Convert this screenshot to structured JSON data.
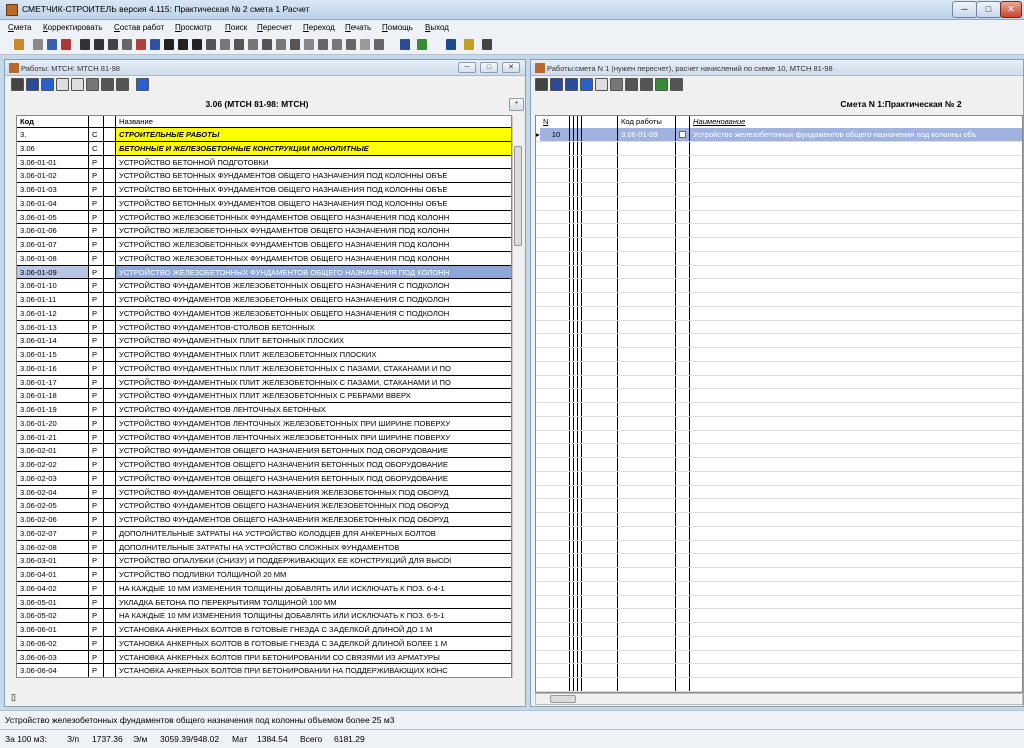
{
  "app": {
    "title": "СМЕТЧИК-СТРОИТЕЛЬ версия  4.115: Практическая № 2 смета 1 Расчет",
    "min": "─",
    "max": "□",
    "close": "✕"
  },
  "menu": [
    {
      "first": "С",
      "rest": "мета"
    },
    {
      "first": "К",
      "rest": "орректировать"
    },
    {
      "first": "С",
      "rest": "остав работ"
    },
    {
      "first": "П",
      "rest": "росмотр"
    },
    {
      "first": "П",
      "rest": "оиск"
    },
    {
      "first": "П",
      "rest": "ересчет"
    },
    {
      "first": "П",
      "rest": "ереход"
    },
    {
      "first": "П",
      "rest": "ечать"
    },
    {
      "first": "П",
      "rest": "омощь"
    },
    {
      "first": "В",
      "rest": "ыход"
    }
  ],
  "left_window": {
    "title": "Работы: МТСН: МТСН 81-98",
    "heading": "3.06 (МТСН 81-98: МТСН)",
    "plus": "+",
    "columns": {
      "code": "Код",
      "name": "Название"
    },
    "rows": [
      {
        "code": "3.",
        "type": "С",
        "name": "СТРОИТЕЛЬНЫЕ РАБОТЫ",
        "style": "section"
      },
      {
        "code": "3.06",
        "type": "С",
        "name": "БЕТОННЫЕ И ЖЕЛЕЗОБЕТОННЫЕ КОНСТРУКЦИИ МОНОЛИТНЫЕ",
        "style": "section"
      },
      {
        "code": "3.06-01-01",
        "type": "Р",
        "name": "УСТРОЙСТВО БЕТОННОЙ ПОДГОТОВКИ"
      },
      {
        "code": "3.06-01-02",
        "type": "Р",
        "name": "УСТРОЙСТВО БЕТОННЫХ ФУНДАМЕНТОВ ОБЩЕГО НАЗНАЧЕНИЯ ПОД КОЛОННЫ ОБЪЕ"
      },
      {
        "code": "3.06-01-03",
        "type": "Р",
        "name": "УСТРОЙСТВО БЕТОННЫХ ФУНДАМЕНТОВ ОБЩЕГО НАЗНАЧЕНИЯ ПОД КОЛОННЫ ОБЪЕ"
      },
      {
        "code": "3.06-01-04",
        "type": "Р",
        "name": "УСТРОЙСТВО БЕТОННЫХ ФУНДАМЕНТОВ ОБЩЕГО НАЗНАЧЕНИЯ ПОД КОЛОННЫ ОБЪЕ"
      },
      {
        "code": "3.06-01-05",
        "type": "Р",
        "name": "УСТРОЙСТВО ЖЕЛЕЗОБЕТОННЫХ ФУНДАМЕНТОВ ОБЩЕГО НАЗНАЧЕНИЯ ПОД КОЛОНН"
      },
      {
        "code": "3.06-01-06",
        "type": "Р",
        "name": "УСТРОЙСТВО ЖЕЛЕЗОБЕТОННЫХ ФУНДАМЕНТОВ ОБЩЕГО НАЗНАЧЕНИЯ ПОД КОЛОНН"
      },
      {
        "code": "3.06-01-07",
        "type": "Р",
        "name": "УСТРОЙСТВО ЖЕЛЕЗОБЕТОННЫХ ФУНДАМЕНТОВ ОБЩЕГО НАЗНАЧЕНИЯ ПОД КОЛОНН"
      },
      {
        "code": "3.06-01-08",
        "type": "Р",
        "name": "УСТРОЙСТВО ЖЕЛЕЗОБЕТОННЫХ ФУНДАМЕНТОВ ОБЩЕГО НАЗНАЧЕНИЯ ПОД КОЛОНН"
      },
      {
        "code": "3.06-01-09",
        "type": "Р",
        "name": "УСТРОЙСТВО ЖЕЛЕЗОБЕТОННЫХ ФУНДАМЕНТОВ ОБЩЕГО НАЗНАЧЕНИЯ ПОД КОЛОНН",
        "style": "selected"
      },
      {
        "code": "3.06-01-10",
        "type": "Р",
        "name": "УСТРОЙСТВО ФУНДАМЕНТОВ ЖЕЛЕЗОБЕТОННЫХ ОБЩЕГО НАЗНАЧЕНИЯ С ПОДКОЛОН"
      },
      {
        "code": "3.06-01-11",
        "type": "Р",
        "name": "УСТРОЙСТВО ФУНДАМЕНТОВ ЖЕЛЕЗОБЕТОННЫХ ОБЩЕГО НАЗНАЧЕНИЯ С ПОДКОЛОН"
      },
      {
        "code": "3.06-01-12",
        "type": "Р",
        "name": "УСТРОЙСТВО ФУНДАМЕНТОВ ЖЕЛЕЗОБЕТОННЫХ ОБЩЕГО НАЗНАЧЕНИЯ С ПОДКОЛОН"
      },
      {
        "code": "3.06-01-13",
        "type": "Р",
        "name": "УСТРОЙСТВО ФУНДАМЕНТОВ-СТОЛБОВ БЕТОННЫХ"
      },
      {
        "code": "3.06-01-14",
        "type": "Р",
        "name": "УСТРОЙСТВО ФУНДАМЕНТНЫХ ПЛИТ БЕТОННЫХ ПЛОСКИХ"
      },
      {
        "code": "3.06-01-15",
        "type": "Р",
        "name": "УСТРОЙСТВО ФУНДАМЕНТНЫХ ПЛИТ ЖЕЛЕЗОБЕТОННЫХ ПЛОСКИХ"
      },
      {
        "code": "3.06-01-16",
        "type": "Р",
        "name": "УСТРОЙСТВО ФУНДАМЕНТНЫХ ПЛИТ ЖЕЛЕЗОБЕТОННЫХ С ПАЗАМИ, СТАКАНАМИ И ПО"
      },
      {
        "code": "3.06-01-17",
        "type": "Р",
        "name": "УСТРОЙСТВО ФУНДАМЕНТНЫХ ПЛИТ ЖЕЛЕЗОБЕТОННЫХ С ПАЗАМИ, СТАКАНАМИ И ПО"
      },
      {
        "code": "3.06-01-18",
        "type": "Р",
        "name": "УСТРОЙСТВО ФУНДАМЕНТНЫХ ПЛИТ ЖЕЛЕЗОБЕТОННЫХ С РЕБРАМИ ВВЕРХ"
      },
      {
        "code": "3.06-01-19",
        "type": "Р",
        "name": "УСТРОЙСТВО ФУНДАМЕНТОВ ЛЕНТОЧНЫХ БЕТОННЫХ"
      },
      {
        "code": "3.06-01-20",
        "type": "Р",
        "name": "УСТРОЙСТВО ФУНДАМЕНТОВ ЛЕНТОЧНЫХ ЖЕЛЕЗОБЕТОННЫХ ПРИ ШИРИНЕ ПОВЕРХУ"
      },
      {
        "code": "3.06-01-21",
        "type": "Р",
        "name": "УСТРОЙСТВО ФУНДАМЕНТОВ ЛЕНТОЧНЫХ ЖЕЛЕЗОБЕТОННЫХ ПРИ ШИРИНЕ ПОВЕРХУ"
      },
      {
        "code": "3.06-02-01",
        "type": "Р",
        "name": "УСТРОЙСТВО ФУНДАМЕНТОВ ОБЩЕГО НАЗНАЧЕНИЯ БЕТОННЫХ ПОД ОБОРУДОВАНИЕ"
      },
      {
        "code": "3.06-02-02",
        "type": "Р",
        "name": "УСТРОЙСТВО ФУНДАМЕНТОВ ОБЩЕГО НАЗНАЧЕНИЯ БЕТОННЫХ ПОД ОБОРУДОВАНИЕ"
      },
      {
        "code": "3.06-02-03",
        "type": "Р",
        "name": "УСТРОЙСТВО ФУНДАМЕНТОВ ОБЩЕГО НАЗНАЧЕНИЯ БЕТОННЫХ ПОД ОБОРУДОВАНИЕ"
      },
      {
        "code": "3.06-02-04",
        "type": "Р",
        "name": "УСТРОЙСТВО ФУНДАМЕНТОВ ОБЩЕГО НАЗНАЧЕНИЯ ЖЕЛЕЗОБЕТОННЫХ ПОД ОБОРУД"
      },
      {
        "code": "3.06-02-05",
        "type": "Р",
        "name": "УСТРОЙСТВО ФУНДАМЕНТОВ ОБЩЕГО НАЗНАЧЕНИЯ ЖЕЛЕЗОБЕТОННЫХ ПОД ОБОРУД"
      },
      {
        "code": "3.06-02-06",
        "type": "Р",
        "name": "УСТРОЙСТВО ФУНДАМЕНТОВ ОБЩЕГО НАЗНАЧЕНИЯ ЖЕЛЕЗОБЕТОННЫХ ПОД ОБОРУД"
      },
      {
        "code": "3.06-02-07",
        "type": "Р",
        "name": "ДОПОЛНИТЕЛЬНЫЕ ЗАТРАТЫ НА УСТРОЙСТВО КОЛОДЦЕВ ДЛЯ АНКЕРНЫХ БОЛТОВ"
      },
      {
        "code": "3.06-02-08",
        "type": "Р",
        "name": "ДОПОЛНИТЕЛЬНЫЕ ЗАТРАТЫ НА УСТРОЙСТВО СЛОЖНЫХ ФУНДАМЕНТОВ"
      },
      {
        "code": "3.06-03-01",
        "type": "Р",
        "name": "УСТРОЙСТВО ОПАЛУБКИ (СНИЗУ) И ПОДДЕРЖИВАЮЩИХ ЕЕ КОНСТРУКЦИЙ ДЛЯ ВЫСОІ"
      },
      {
        "code": "3.06-04-01",
        "type": "Р",
        "name": "УСТРОЙСТВО ПОДЛИВКИ ТОЛЩИНОЙ 20 ММ"
      },
      {
        "code": "3.06-04-02",
        "type": "Р",
        "name": "НА КАЖДЫЕ 10 ММ ИЗМЕНЕНИЯ ТОЛЩИНЫ ДОБАВЛЯТЬ ИЛИ ИСКЛЮЧАТЬ К ПОЗ. 6-4-1"
      },
      {
        "code": "3.06-05-01",
        "type": "Р",
        "name": "УКЛАДКА БЕТОНА ПО ПЕРЕКРЫТИЯМ ТОЛЩИНОЙ 100 ММ"
      },
      {
        "code": "3.06-05-02",
        "type": "Р",
        "name": "НА КАЖДЫЕ 10 ММ ИЗМЕНЕНИЯ ТОЛЩИНЫ ДОБАВЛЯТЬ ИЛИ ИСКЛЮЧАТЬ К ПОЗ. 6-5-1"
      },
      {
        "code": "3.06-06-01",
        "type": "Р",
        "name": "УСТАНОВКА АНКЕРНЫХ БОЛТОВ В ГОТОВЫЕ ГНЕЗДА С ЗАДЕЛКОЙ ДЛИНОЙ ДО 1 М"
      },
      {
        "code": "3.06-06-02",
        "type": "Р",
        "name": "УСТАНОВКА АНКЕРНЫХ БОЛТОВ В ГОТОВЫЕ ГНЕЗДА С ЗАДЕЛКОЙ ДЛИНОЙ БОЛЕЕ 1 М"
      },
      {
        "code": "3.06-06-03",
        "type": "Р",
        "name": "УСТАНОВКА АНКЕРНЫХ БОЛТОВ ПРИ БЕТОНИРОВАНИИ СО СВЯЗЯМИ ИЗ АРМАТУРЫ"
      },
      {
        "code": "3.06-06-04",
        "type": "Р",
        "name": "УСТАНОВКА АНКЕРНЫХ БОЛТОВ ПРИ БЕТОНИРОВАНИИ НА ПОДДЕРЖИВАЮЩИХ КОНС"
      }
    ]
  },
  "right_window": {
    "title": "Работы:смета  N 1 (нужен пересчет), расчет начислений по схеме 10, МТСН 81-98",
    "heading": "Смета N 1:Практическая № 2",
    "columns": {
      "n": "N",
      "code": "Код работы",
      "name": "Наименование"
    },
    "rows": [
      {
        "n": "10",
        "code": "3.06-01-09",
        "name": "Устройство железобетонных фундаментов общего назначения под колонны объ"
      }
    ]
  },
  "status": {
    "description": "Устройство железобетонных фундаментов общего назначения под колонны объемом более 25 м3",
    "per_unit": "За 100 м3:",
    "zp_label": "З/п",
    "zp_value": "1737.36",
    "em_label": "Э/м",
    "em_value": "3059.39/948.02",
    "mat_label": "Мат",
    "mat_value": "1384.54",
    "total_label": "Всего",
    "total_value": "6181.29"
  },
  "colors": {
    "section_bg": "#ffff00",
    "selected_bg": "#8fa6d8",
    "right_selected_bg": "#9fb2e0"
  }
}
